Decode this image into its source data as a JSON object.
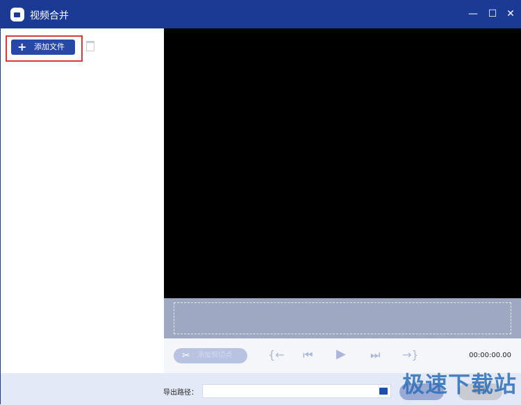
{
  "window": {
    "title": "视频合并",
    "minimize": "—",
    "maximize": "☐",
    "close": "✕"
  },
  "sidebar": {
    "add_file": "添加文件",
    "add_icon": "+"
  },
  "controls": {
    "cut_label": "添加剪切点",
    "cut_icon": "✂",
    "mark_in": "{←",
    "prev": "⏮",
    "play": "▶",
    "next": "⏭",
    "mark_out": "→}",
    "time": "00:00:00.00"
  },
  "bottom": {
    "path_label": "导出路径：",
    "path_value": "",
    "cancel": "取消"
  },
  "watermark": "极速下载站"
}
